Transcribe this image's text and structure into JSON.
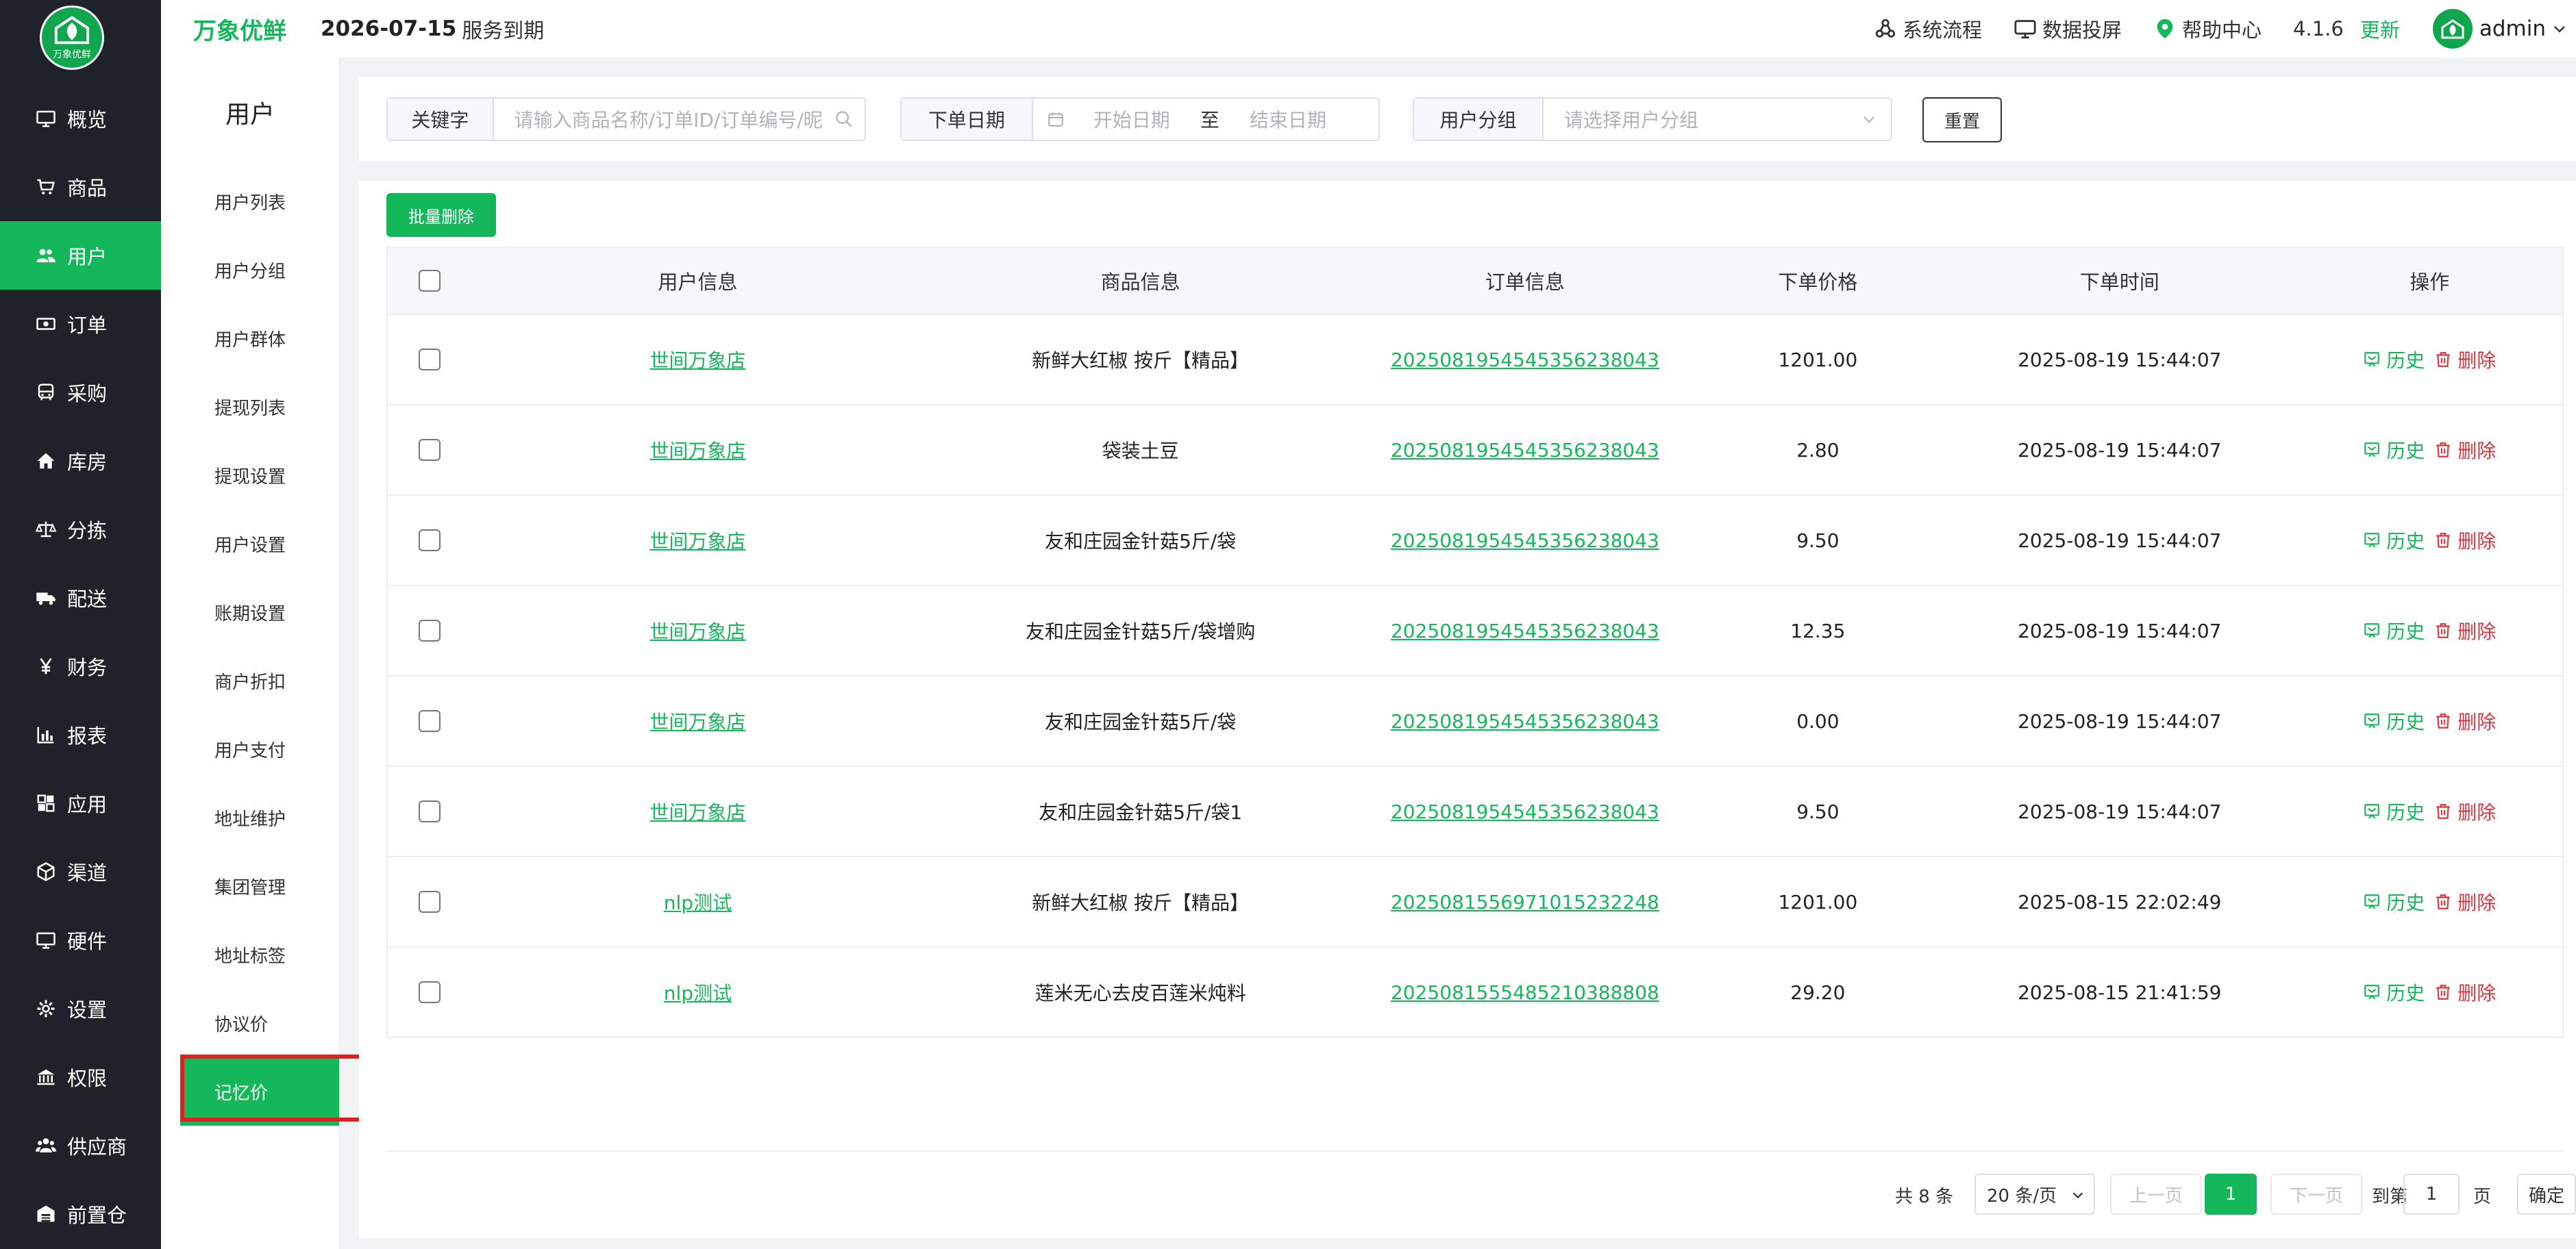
{
  "brand": {
    "name": "万象优鲜",
    "logo_text": "万象优鲜",
    "accent": "#14b85a",
    "sidebar_bg": "#1f2329"
  },
  "header": {
    "expire_date": "2026-07-15",
    "expire_text": "服务到期",
    "links": [
      {
        "label": "系统流程",
        "icon": "flow-icon"
      },
      {
        "label": "数据投屏",
        "icon": "monitor-icon"
      },
      {
        "label": "帮助中心",
        "icon": "location-pin-icon"
      }
    ],
    "version": "4.1.6",
    "update_label": "更新",
    "user_name": "admin"
  },
  "sidebar": {
    "items": [
      {
        "label": "概览",
        "icon": "monitor-icon"
      },
      {
        "label": "商品",
        "icon": "cart-icon"
      },
      {
        "label": "用户",
        "icon": "users-icon",
        "active": true
      },
      {
        "label": "订单",
        "icon": "money-icon"
      },
      {
        "label": "采购",
        "icon": "bus-icon"
      },
      {
        "label": "库房",
        "icon": "home-icon"
      },
      {
        "label": "分拣",
        "icon": "scale-icon"
      },
      {
        "label": "配送",
        "icon": "truck-icon"
      },
      {
        "label": "财务",
        "icon": "yen-icon"
      },
      {
        "label": "报表",
        "icon": "bar-chart-icon"
      },
      {
        "label": "应用",
        "icon": "apps-icon"
      },
      {
        "label": "渠道",
        "icon": "cube-icon"
      },
      {
        "label": "硬件",
        "icon": "desktop-icon"
      },
      {
        "label": "设置",
        "icon": "gear-icon"
      },
      {
        "label": "权限",
        "icon": "bank-icon"
      },
      {
        "label": "供应商",
        "icon": "group-icon"
      },
      {
        "label": "前置仓",
        "icon": "warehouse-icon"
      }
    ]
  },
  "subnav": {
    "title": "用户",
    "items": [
      {
        "label": "用户列表"
      },
      {
        "label": "用户分组"
      },
      {
        "label": "用户群体"
      },
      {
        "label": "提现列表"
      },
      {
        "label": "提现设置"
      },
      {
        "label": "用户设置"
      },
      {
        "label": "账期设置"
      },
      {
        "label": "商户折扣"
      },
      {
        "label": "用户支付"
      },
      {
        "label": "地址维护"
      },
      {
        "label": "集团管理"
      },
      {
        "label": "地址标签"
      },
      {
        "label": "协议价"
      },
      {
        "label": "记忆价",
        "active": true
      }
    ]
  },
  "filters": {
    "keyword_label": "关键字",
    "keyword_placeholder": "请输入商品名称/订单ID/订单编号/昵",
    "date_label": "下单日期",
    "start_placeholder": "开始日期",
    "date_sep": "至",
    "end_placeholder": "结束日期",
    "group_label": "用户分组",
    "group_placeholder": "请选择用户分组",
    "reset_label": "重置"
  },
  "table": {
    "batch_delete_label": "批量删除",
    "headers": [
      "用户信息",
      "商品信息",
      "订单信息",
      "下单价格",
      "下单时间",
      "操作"
    ],
    "history_label": "历史",
    "delete_label": "删除",
    "rows": [
      {
        "user": "世间万象店",
        "product": "新鲜大红椒 按斤【精品】",
        "order": "2025081954545356238043",
        "price": "1201.00",
        "time": "2025-08-19 15:44:07"
      },
      {
        "user": "世间万象店",
        "product": "袋装土豆",
        "order": "2025081954545356238043",
        "price": "2.80",
        "time": "2025-08-19 15:44:07"
      },
      {
        "user": "世间万象店",
        "product": "友和庄园金针菇5斤/袋",
        "order": "2025081954545356238043",
        "price": "9.50",
        "time": "2025-08-19 15:44:07"
      },
      {
        "user": "世间万象店",
        "product": "友和庄园金针菇5斤/袋增购",
        "order": "2025081954545356238043",
        "price": "12.35",
        "time": "2025-08-19 15:44:07"
      },
      {
        "user": "世间万象店",
        "product": "友和庄园金针菇5斤/袋",
        "order": "2025081954545356238043",
        "price": "0.00",
        "time": "2025-08-19 15:44:07"
      },
      {
        "user": "世间万象店",
        "product": "友和庄园金针菇5斤/袋1",
        "order": "2025081954545356238043",
        "price": "9.50",
        "time": "2025-08-19 15:44:07"
      },
      {
        "user": "nlp测试",
        "product": "新鲜大红椒 按斤【精品】",
        "order": "2025081556971015232248",
        "price": "1201.00",
        "time": "2025-08-15 22:02:49"
      },
      {
        "user": "nlp测试",
        "product": "莲米无心去皮百莲米炖料",
        "order": "2025081555485210388808",
        "price": "29.20",
        "time": "2025-08-15 21:41:59"
      }
    ]
  },
  "pagination": {
    "total": "共 8 条",
    "page_size": "20 条/页",
    "prev": "上一页",
    "current": "1",
    "next": "下一页",
    "goto_label": "到第",
    "goto_value": "1",
    "page_unit": "页",
    "confirm": "确定"
  }
}
